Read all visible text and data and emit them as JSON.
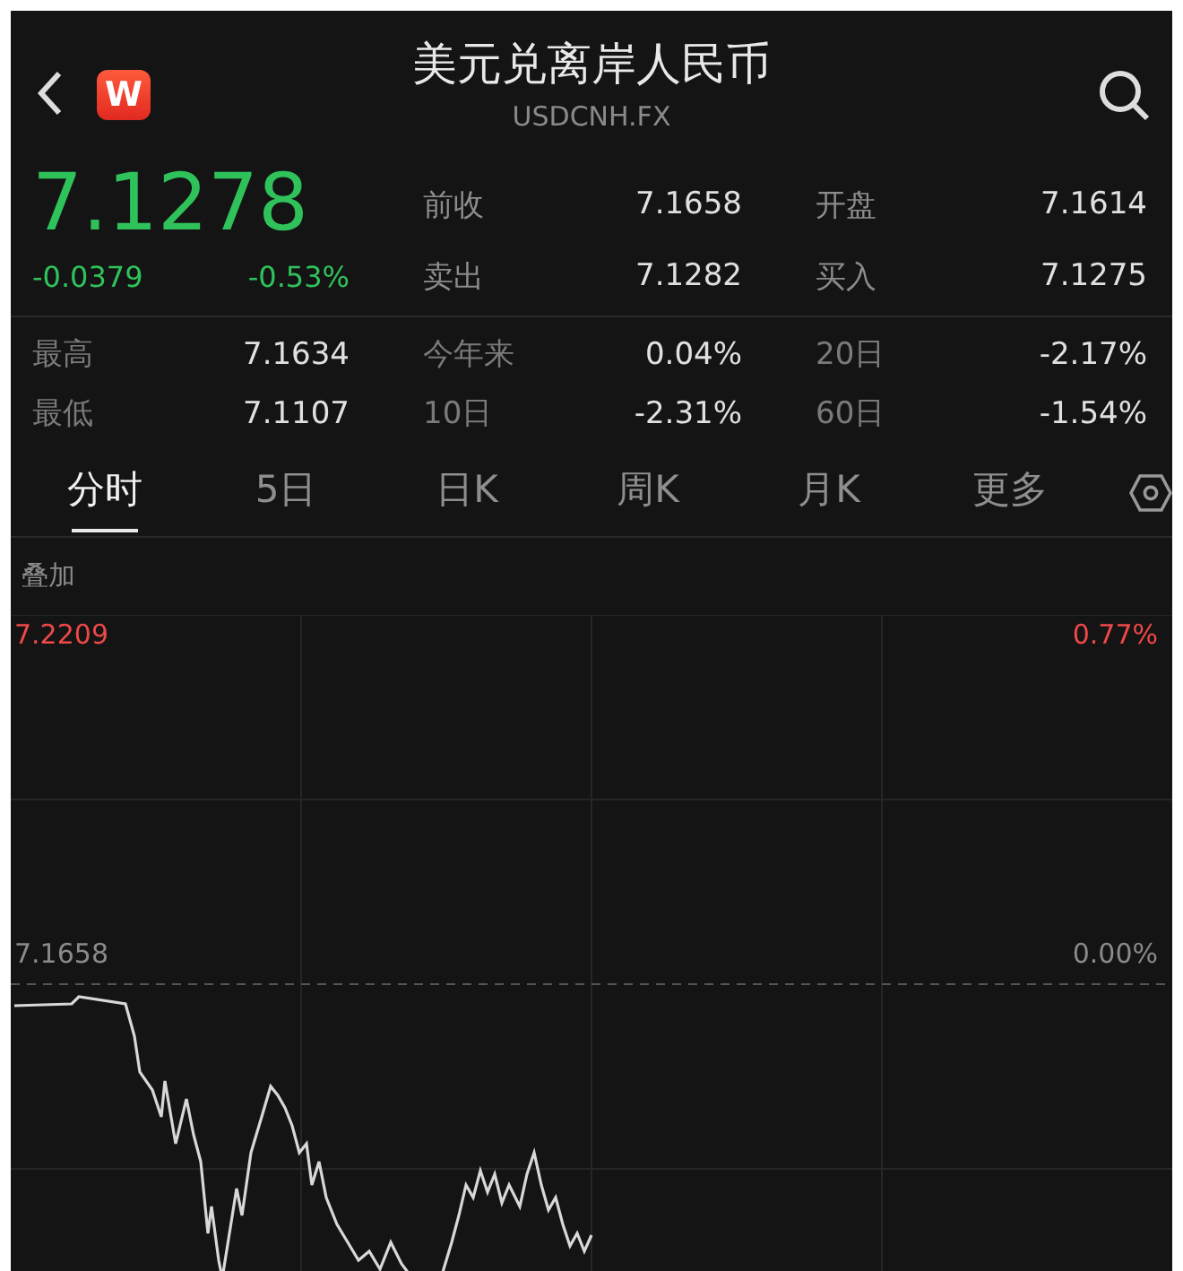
{
  "header": {
    "logo_letter": "W",
    "title": "美元兑离岸人民币",
    "subtitle": "USDCNH.FX"
  },
  "quote": {
    "price": "7.1278",
    "change": "-0.0379",
    "change_percent": "-0.53%",
    "rising": false,
    "fields": [
      {
        "label": "前收",
        "value": "7.1658"
      },
      {
        "label": "开盘",
        "value": "7.1614"
      },
      {
        "label": "卖出",
        "value": "7.1282"
      },
      {
        "label": "买入",
        "value": "7.1275"
      }
    ]
  },
  "stats": [
    {
      "label": "最高",
      "value": "7.1634"
    },
    {
      "label": "今年来",
      "value": "0.04%"
    },
    {
      "label": "20日",
      "value": "-2.17%"
    },
    {
      "label": "最低",
      "value": "7.1107"
    },
    {
      "label": "10日",
      "value": "-2.31%"
    },
    {
      "label": "60日",
      "value": "-1.54%"
    }
  ],
  "tabs": [
    {
      "label": "分时",
      "selected": true
    },
    {
      "label": "5日",
      "selected": false
    },
    {
      "label": "日K",
      "selected": false
    },
    {
      "label": "周K",
      "selected": false
    },
    {
      "label": "月K",
      "selected": false
    },
    {
      "label": "更多",
      "selected": false
    }
  ],
  "chart": {
    "overlay_label": "叠加",
    "levels": [
      {
        "price": "7.2209",
        "percent": "0.77%",
        "color": "#f04848"
      },
      {
        "price": "7.1658",
        "percent": "0.00%",
        "color": "#8a8a8a"
      }
    ]
  }
}
